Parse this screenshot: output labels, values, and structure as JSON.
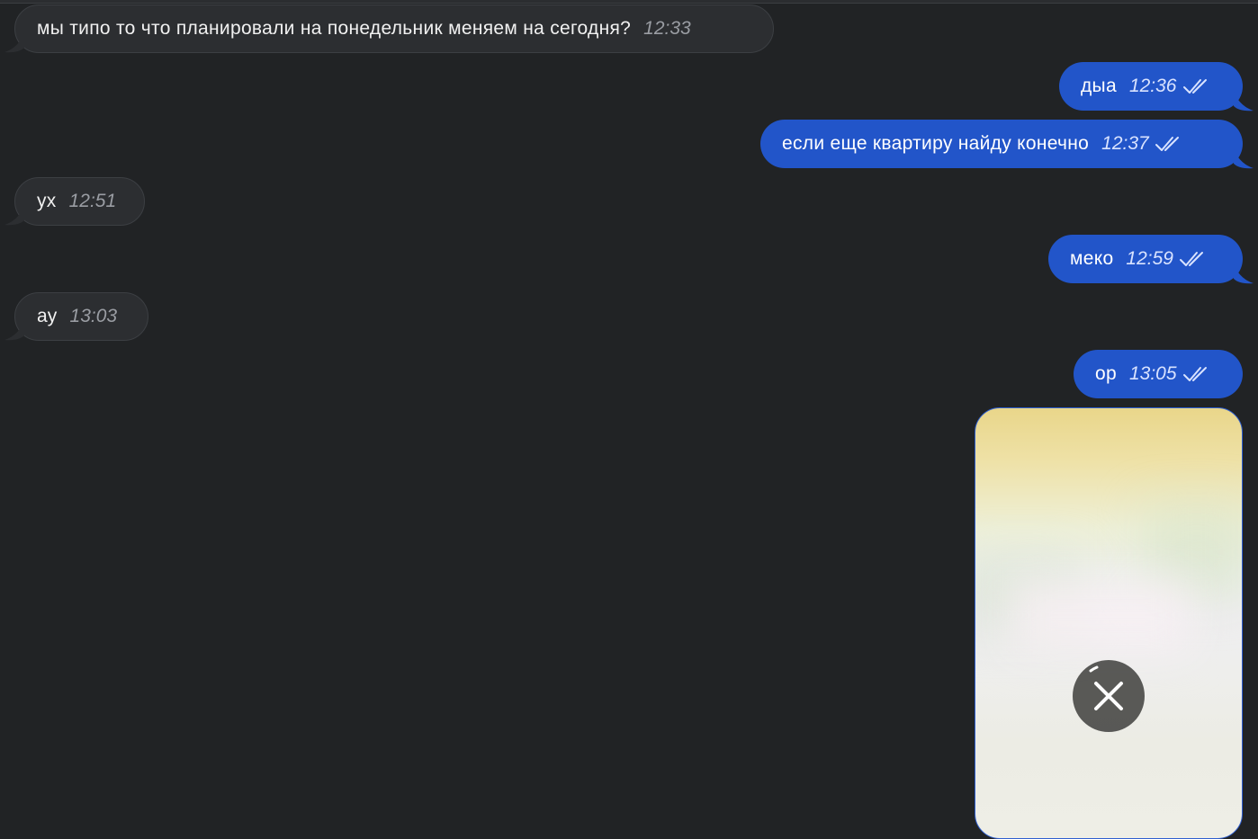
{
  "messages": [
    {
      "direction": "incoming",
      "text": "мы типо то что планировали на понедельник меняем на сегодня?",
      "time": "12:33"
    },
    {
      "direction": "outgoing",
      "text": "дыа",
      "time": "12:36",
      "status": "read"
    },
    {
      "direction": "outgoing",
      "text": "если еще квартиру найду конечно",
      "time": "12:37",
      "status": "read"
    },
    {
      "direction": "incoming",
      "text": "ух",
      "time": "12:51"
    },
    {
      "direction": "outgoing",
      "text": "меко",
      "time": "12:59",
      "status": "read"
    },
    {
      "direction": "incoming",
      "text": "ау",
      "time": "13:03"
    },
    {
      "direction": "outgoing",
      "text": "ор",
      "time": "13:05",
      "status": "read"
    }
  ],
  "photo_message": {
    "direction": "outgoing",
    "upload_state": "uploading",
    "cancel_icon": "close-icon"
  },
  "colors": {
    "background": "#212325",
    "incoming_bubble": "#2c2e31",
    "outgoing_bubble": "#2255c9"
  }
}
